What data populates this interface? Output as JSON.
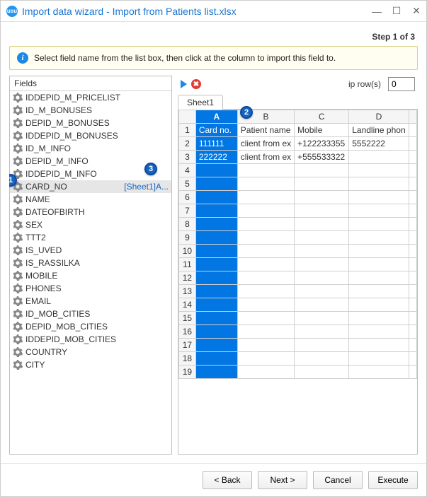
{
  "window": {
    "title": "Import data wizard - Import from Patients list.xlsx"
  },
  "step": "Step 1 of 3",
  "info": "Select field name from the list box, then click at the column to import this field to.",
  "fields_header": "Fields",
  "fields": [
    {
      "label": "IDDEPID_M_PRICELIST"
    },
    {
      "label": "ID_M_BONUSES"
    },
    {
      "label": "DEPID_M_BONUSES"
    },
    {
      "label": "IDDEPID_M_BONUSES"
    },
    {
      "label": "ID_M_INFO"
    },
    {
      "label": "DEPID_M_INFO"
    },
    {
      "label": "IDDEPID_M_INFO"
    },
    {
      "label": "CARD_NO",
      "mapping": "[Sheet1]A...",
      "selected": true
    },
    {
      "label": "NAME"
    },
    {
      "label": "DATEOFBIRTH"
    },
    {
      "label": "SEX"
    },
    {
      "label": "TTT2"
    },
    {
      "label": "IS_UVED"
    },
    {
      "label": "IS_RASSILKA"
    },
    {
      "label": "MOBILE"
    },
    {
      "label": "PHONES"
    },
    {
      "label": "EMAIL"
    },
    {
      "label": "ID_MOB_CITIES"
    },
    {
      "label": "DEPID_MOB_CITIES"
    },
    {
      "label": "IDDEPID_MOB_CITIES"
    },
    {
      "label": "COUNTRY"
    },
    {
      "label": "CITY"
    }
  ],
  "skip_label": "ip row(s)",
  "skip_value": "0",
  "sheet_tab": "Sheet1",
  "grid": {
    "cols": [
      "A",
      "B",
      "C",
      "D"
    ],
    "rows": [
      {
        "n": "1",
        "cells": [
          "Card no.",
          "Patient name",
          "Mobile",
          "Landline phon"
        ]
      },
      {
        "n": "2",
        "cells": [
          "111111",
          "client from ex",
          "+122233355",
          "5552222"
        ]
      },
      {
        "n": "3",
        "cells": [
          "222222",
          "client from ex",
          "+555533322",
          ""
        ]
      }
    ],
    "empty_rows": [
      "4",
      "5",
      "6",
      "7",
      "8",
      "9",
      "10",
      "11",
      "12",
      "13",
      "14",
      "15",
      "16",
      "17",
      "18",
      "19"
    ]
  },
  "buttons": {
    "back": "< Back",
    "next": "Next >",
    "cancel": "Cancel",
    "execute": "Execute"
  },
  "callouts": {
    "c1": "1",
    "c2": "2",
    "c3": "3"
  }
}
